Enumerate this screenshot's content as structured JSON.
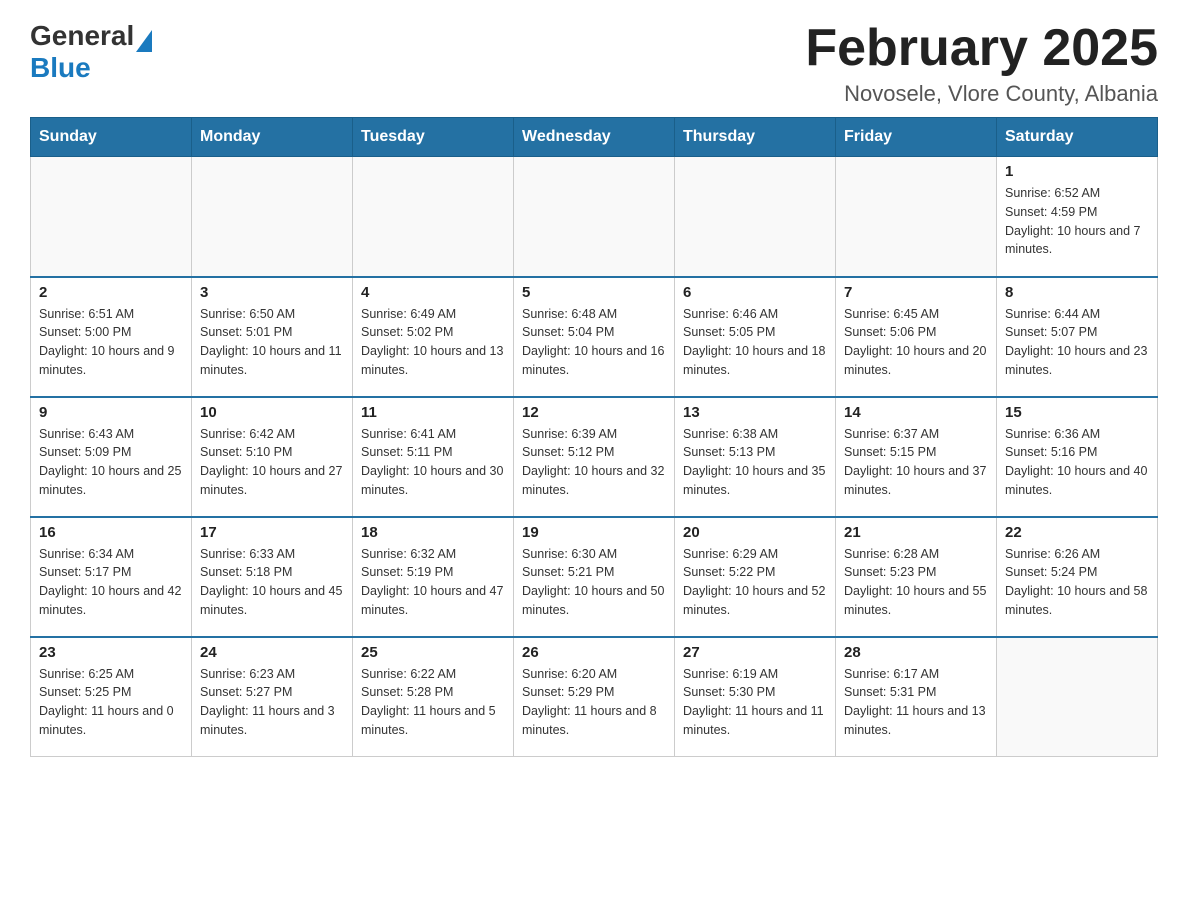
{
  "header": {
    "logo_general": "General",
    "logo_blue": "Blue",
    "title": "February 2025",
    "subtitle": "Novosele, Vlore County, Albania"
  },
  "days_of_week": [
    "Sunday",
    "Monday",
    "Tuesday",
    "Wednesday",
    "Thursday",
    "Friday",
    "Saturday"
  ],
  "weeks": [
    [
      {
        "day": "",
        "info": ""
      },
      {
        "day": "",
        "info": ""
      },
      {
        "day": "",
        "info": ""
      },
      {
        "day": "",
        "info": ""
      },
      {
        "day": "",
        "info": ""
      },
      {
        "day": "",
        "info": ""
      },
      {
        "day": "1",
        "info": "Sunrise: 6:52 AM\nSunset: 4:59 PM\nDaylight: 10 hours and 7 minutes."
      }
    ],
    [
      {
        "day": "2",
        "info": "Sunrise: 6:51 AM\nSunset: 5:00 PM\nDaylight: 10 hours and 9 minutes."
      },
      {
        "day": "3",
        "info": "Sunrise: 6:50 AM\nSunset: 5:01 PM\nDaylight: 10 hours and 11 minutes."
      },
      {
        "day": "4",
        "info": "Sunrise: 6:49 AM\nSunset: 5:02 PM\nDaylight: 10 hours and 13 minutes."
      },
      {
        "day": "5",
        "info": "Sunrise: 6:48 AM\nSunset: 5:04 PM\nDaylight: 10 hours and 16 minutes."
      },
      {
        "day": "6",
        "info": "Sunrise: 6:46 AM\nSunset: 5:05 PM\nDaylight: 10 hours and 18 minutes."
      },
      {
        "day": "7",
        "info": "Sunrise: 6:45 AM\nSunset: 5:06 PM\nDaylight: 10 hours and 20 minutes."
      },
      {
        "day": "8",
        "info": "Sunrise: 6:44 AM\nSunset: 5:07 PM\nDaylight: 10 hours and 23 minutes."
      }
    ],
    [
      {
        "day": "9",
        "info": "Sunrise: 6:43 AM\nSunset: 5:09 PM\nDaylight: 10 hours and 25 minutes."
      },
      {
        "day": "10",
        "info": "Sunrise: 6:42 AM\nSunset: 5:10 PM\nDaylight: 10 hours and 27 minutes."
      },
      {
        "day": "11",
        "info": "Sunrise: 6:41 AM\nSunset: 5:11 PM\nDaylight: 10 hours and 30 minutes."
      },
      {
        "day": "12",
        "info": "Sunrise: 6:39 AM\nSunset: 5:12 PM\nDaylight: 10 hours and 32 minutes."
      },
      {
        "day": "13",
        "info": "Sunrise: 6:38 AM\nSunset: 5:13 PM\nDaylight: 10 hours and 35 minutes."
      },
      {
        "day": "14",
        "info": "Sunrise: 6:37 AM\nSunset: 5:15 PM\nDaylight: 10 hours and 37 minutes."
      },
      {
        "day": "15",
        "info": "Sunrise: 6:36 AM\nSunset: 5:16 PM\nDaylight: 10 hours and 40 minutes."
      }
    ],
    [
      {
        "day": "16",
        "info": "Sunrise: 6:34 AM\nSunset: 5:17 PM\nDaylight: 10 hours and 42 minutes."
      },
      {
        "day": "17",
        "info": "Sunrise: 6:33 AM\nSunset: 5:18 PM\nDaylight: 10 hours and 45 minutes."
      },
      {
        "day": "18",
        "info": "Sunrise: 6:32 AM\nSunset: 5:19 PM\nDaylight: 10 hours and 47 minutes."
      },
      {
        "day": "19",
        "info": "Sunrise: 6:30 AM\nSunset: 5:21 PM\nDaylight: 10 hours and 50 minutes."
      },
      {
        "day": "20",
        "info": "Sunrise: 6:29 AM\nSunset: 5:22 PM\nDaylight: 10 hours and 52 minutes."
      },
      {
        "day": "21",
        "info": "Sunrise: 6:28 AM\nSunset: 5:23 PM\nDaylight: 10 hours and 55 minutes."
      },
      {
        "day": "22",
        "info": "Sunrise: 6:26 AM\nSunset: 5:24 PM\nDaylight: 10 hours and 58 minutes."
      }
    ],
    [
      {
        "day": "23",
        "info": "Sunrise: 6:25 AM\nSunset: 5:25 PM\nDaylight: 11 hours and 0 minutes."
      },
      {
        "day": "24",
        "info": "Sunrise: 6:23 AM\nSunset: 5:27 PM\nDaylight: 11 hours and 3 minutes."
      },
      {
        "day": "25",
        "info": "Sunrise: 6:22 AM\nSunset: 5:28 PM\nDaylight: 11 hours and 5 minutes."
      },
      {
        "day": "26",
        "info": "Sunrise: 6:20 AM\nSunset: 5:29 PM\nDaylight: 11 hours and 8 minutes."
      },
      {
        "day": "27",
        "info": "Sunrise: 6:19 AM\nSunset: 5:30 PM\nDaylight: 11 hours and 11 minutes."
      },
      {
        "day": "28",
        "info": "Sunrise: 6:17 AM\nSunset: 5:31 PM\nDaylight: 11 hours and 13 minutes."
      },
      {
        "day": "",
        "info": ""
      }
    ]
  ]
}
